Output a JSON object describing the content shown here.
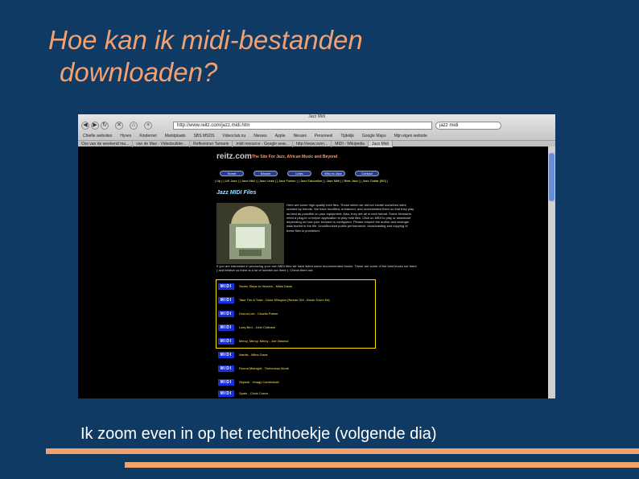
{
  "slide": {
    "title_line1": "Hoe kan ik midi-bestanden",
    "title_line2": "downloaden?",
    "caption": "Ik zoom even in op het rechthoekje (volgende dia)"
  },
  "browser": {
    "window_title": "Jazz Midi",
    "url": "http://www.reitz.com/jazz.midi.htm",
    "search": "jazz midi",
    "bookmarks": [
      "Chiefie websites",
      "Hyves",
      "Kindernet",
      "Marktplaats",
      "SBS MSDS",
      "Videoclub.nu",
      "Nieuws",
      "Apple",
      "Nieuws",
      "Personeel",
      "Tijdelijk",
      "Google Maps",
      "Mijn eigen website"
    ],
    "tabs": [
      "Oss van de weekend ma...",
      "van de Max - Videobuilder...",
      "Reflexioner Tamarin",
      "midi resource - Google sear...",
      "http://www.vsnn...",
      "MIDI - Wikipedia",
      "Jazz Midi"
    ],
    "active_tab": 6
  },
  "site": {
    "logo": "reitz.com",
    "tagline": "The Site For Jazz, African Music and Beyond",
    "nav_buttons": [
      "Home",
      "Search",
      "Links",
      "Who is Jazz",
      "Contact"
    ],
    "breadcrumbs": "| Up | | UK Jazz | | Jazz Midi | | Jazz Links | | Jazz Fusion | | Jazz Education | | Jazz Midi | | Best Jazz | | Jazz Guitar (BG) |",
    "heading": "Jazz MIDI Files",
    "intro": "Here are some high-quality midi files. Those which we did not create ourselves were created by friends. We have modified, enhanced, and orchestrated them so that they play as best as possible on your equipment. Also, they are all in midi format. Some browsers need a plug-in or helper application to play midi files. Click on MIDI to play or download depending on how your browser is configured. Please respect the author and arranger data buried in the file. Unauthorized public performance, broadcasting and copying of these files is prohibited.",
    "para2": "If you are interested in producing your own MIDI files we have listed some recommended books. These are some of the best books out there ( and believe us there is a lot of rubbish out there ). Check them out.",
    "midi_label": "MIDI",
    "midi_files": [
      "Seven Steps to Heaven - Miles Davis",
      "Take The A Train - Duke Ellington (Needs GM - Brush Drum Kit)",
      "Donna Lee - Charlie Parker",
      "Lazy Bird - John Coltrane",
      "Mercy, Mercy, Mercy - Joe Zawinul",
      "Nardis - Miles Davis",
      "Round Midnight - Thelonious Monk",
      "Skylark - Hoagy Carmichael",
      "Spain - Chick Corea"
    ]
  }
}
